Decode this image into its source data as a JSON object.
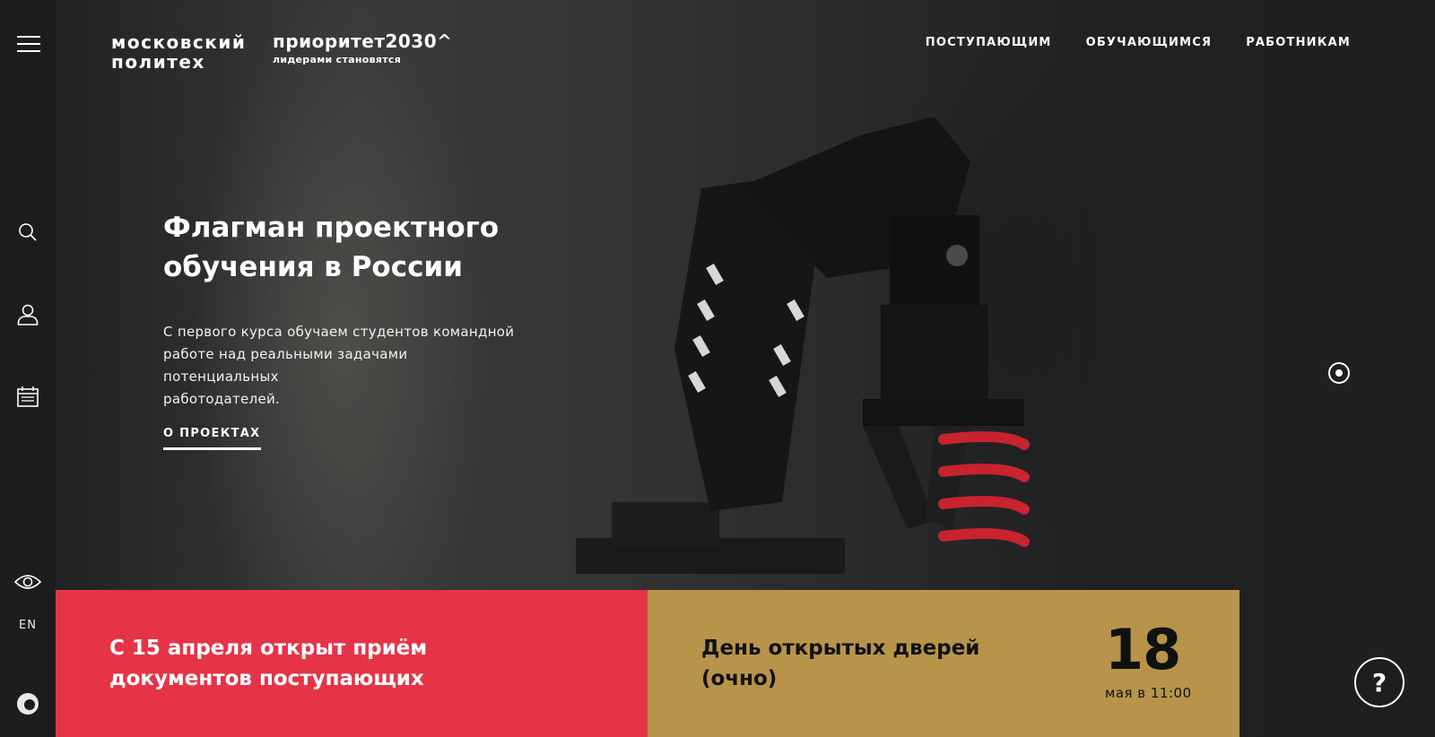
{
  "brand": {
    "line1": "московский",
    "line2": "политех"
  },
  "priority": {
    "title": "приоритет2030^",
    "tagline": "лидерами становятся"
  },
  "nav": {
    "items": [
      "ПОСТУПАЮЩИМ",
      "ОБУЧАЮЩИМСЯ",
      "РАБОТНИКАМ"
    ]
  },
  "sidebar": {
    "icons": [
      "menu-icon",
      "search-icon",
      "user-icon",
      "calendar-icon",
      "eye-icon",
      "logo-icon"
    ],
    "lang": "EN"
  },
  "hero": {
    "title_line1": "Флагман проектного",
    "title_line2": "обучения в России",
    "lead_line1": "С первого курса обучаем студентов командной",
    "lead_line2": "работе над реальными задачами потенциальных",
    "lead_line3": "работодателей.",
    "link": "О ПРОЕКТАХ"
  },
  "cards": {
    "admission": {
      "line1": "С 15 апреля открыт приём",
      "line2": "документов поступающих"
    },
    "open_day": {
      "line1": "День открытых дверей",
      "line2": "(очно)",
      "day": "18",
      "when": "мая в 11:00"
    }
  },
  "help": {
    "label": "?"
  },
  "colors": {
    "rail": "#1c1d1e",
    "card_red": "#e53448",
    "card_gold": "#b79449"
  }
}
